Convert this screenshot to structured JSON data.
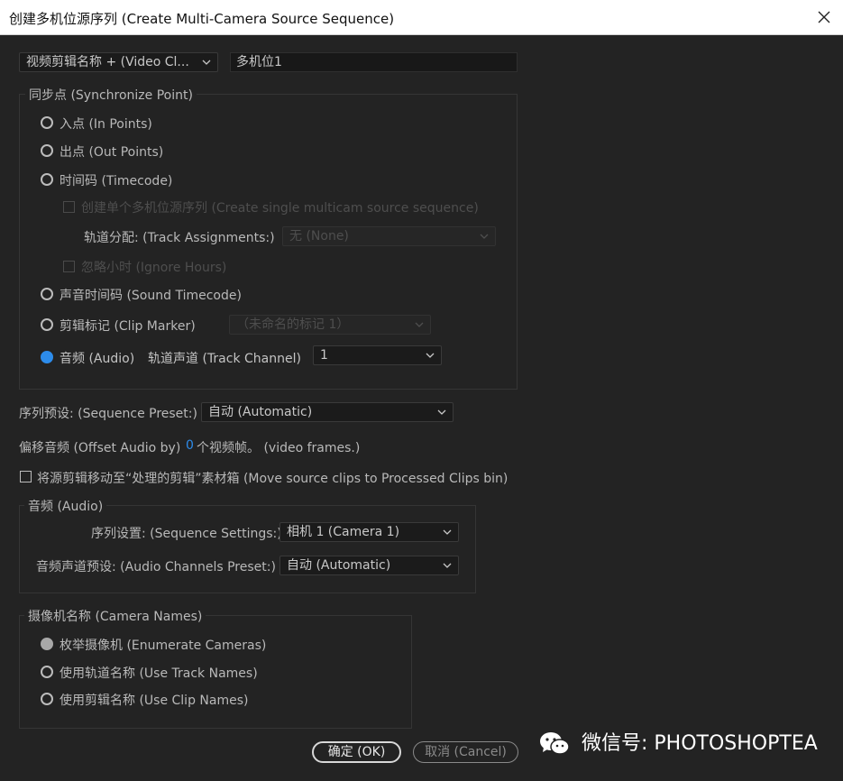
{
  "window": {
    "title": "创建多机位源序列 (Create Multi-Camera Source Sequence)"
  },
  "name_source": {
    "selected": "视频剪辑名称 + (Video Cl...",
    "name_value": "多机位1"
  },
  "sync": {
    "group_label": "同步点 (Synchronize Point)",
    "in_points": "入点 (In Points)",
    "out_points": "出点 (Out Points)",
    "timecode": "时间码 (Timecode)",
    "create_single": "创建单个多机位源序列 (Create single multicam source sequence)",
    "track_assignments_label": "轨道分配: (Track Assignments:)",
    "track_assignments_value": "无 (None)",
    "ignore_hours": "忽略小时 (Ignore Hours)",
    "sound_timecode": "声音时间码 (Sound Timecode)",
    "clip_marker": "剪辑标记 (Clip Marker)",
    "clip_marker_value": "（未命名的标记 1）",
    "audio": "音频 (Audio)",
    "track_channel_label": "轨道声道 (Track Channel)",
    "track_channel_value": "1",
    "selected_option": "audio"
  },
  "sequence_preset": {
    "label": "序列预设: (Sequence Preset:)",
    "value": "自动 (Automatic)"
  },
  "offset_audio": {
    "label": "偏移音频 (Offset Audio by)",
    "value": "0",
    "unit": "个视频帧。 (video frames.)"
  },
  "move_source": {
    "label": "将源剪辑移动至“处理的剪辑”素材箱 (Move source clips to Processed Clips bin)",
    "checked": false
  },
  "audio_group": {
    "group_label": "音频 (Audio)",
    "sequence_settings_label": "序列设置: (Sequence Settings:)",
    "sequence_settings_value": "相机 1 (Camera 1)",
    "channels_preset_label": "音频声道预设: (Audio Channels Preset:)",
    "channels_preset_value": "自动 (Automatic)"
  },
  "camera_names": {
    "group_label": "摄像机名称 (Camera Names)",
    "enumerate": "枚举摄像机 (Enumerate Cameras)",
    "track_names": "使用轨道名称 (Use Track Names)",
    "clip_names": "使用剪辑名称 (Use Clip Names)",
    "selected_option": "enumerate"
  },
  "buttons": {
    "ok": "确定 (OK)",
    "cancel": "取消 (Cancel)"
  },
  "watermark": {
    "text": "微信号: PHOTOSHOPTEA"
  },
  "colors": {
    "accent": "#2d8ceb",
    "background": "#232323",
    "titlebar": "#ffffff"
  }
}
